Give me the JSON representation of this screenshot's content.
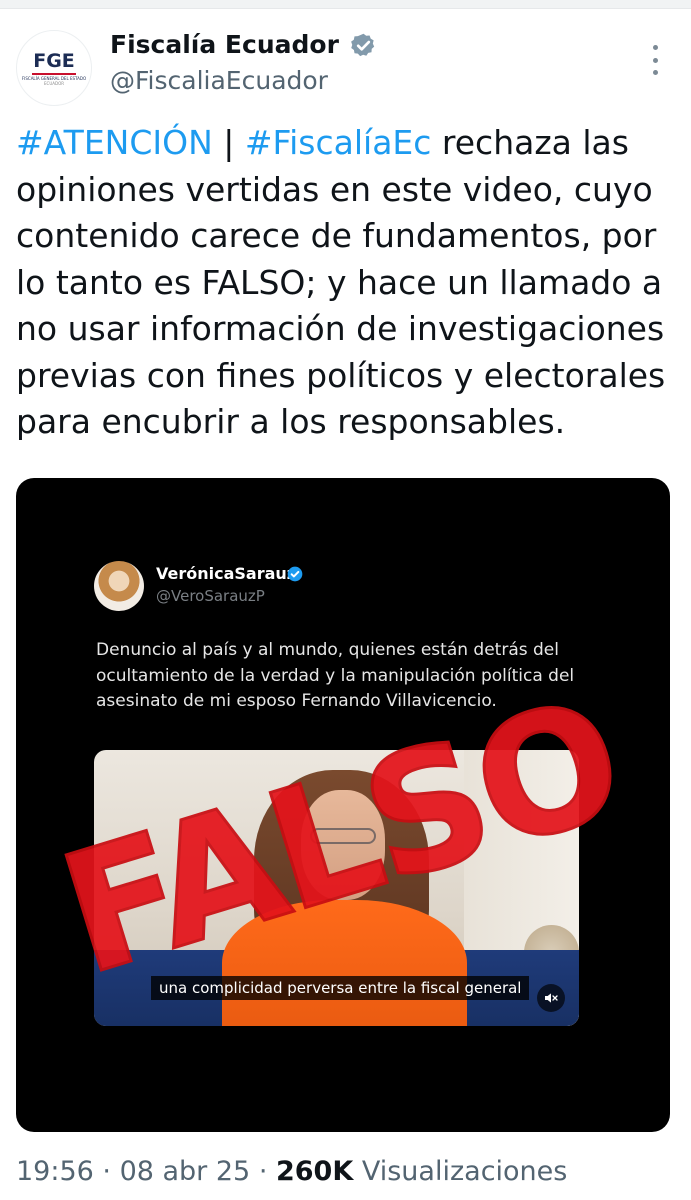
{
  "account": {
    "name": "Fiscalía Ecuador",
    "handle": "@FiscaliaEcuador",
    "logo_text": "FGE",
    "logo_subtext": "FISCALÍA GENERAL DEL ESTADO",
    "logo_subtext2": "ECUADOR",
    "verified_icon": "verified-badge-icon",
    "more_icon": "more-options-icon"
  },
  "tweet": {
    "hashtag1": "#ATENCIÓN",
    "separator": " | ",
    "hashtag2": "#FiscalíaEc",
    "body": " rechaza las opiniones vertidas en este video, cuyo contenido carece de fundamentos, por lo tanto es FALSO; y hace un llamado a no usar información de investigaciones previas con fines políticos y electorales para encubrir a los responsables."
  },
  "embedded_post": {
    "name": "VerónicaSarauz",
    "handle": "@VeroSarauzP",
    "text": "Denuncio al país y al mundo, quienes están detrás del ocultamiento de la verdad y la manipulación política del asesinato de mi esposo Fernando Villavicencio.",
    "video_caption": "una complicidad perversa entre la fiscal general",
    "mute_icon": "muted-speaker-icon"
  },
  "stamp_text": "FALSO",
  "meta": {
    "time": "19:56",
    "dot1": " · ",
    "date": "08 abr 25",
    "dot2": " · ",
    "views_count": "260K",
    "views_label": " Visualizaciones"
  },
  "colors": {
    "link": "#1d9bf0",
    "stamp": "#e4141b",
    "verified": "#829aab",
    "muted_text": "#536471"
  }
}
